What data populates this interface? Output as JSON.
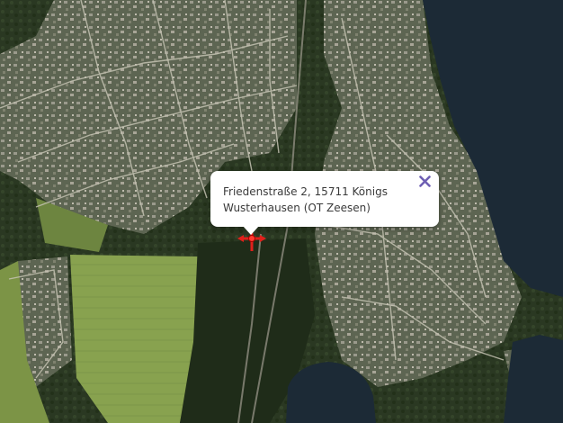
{
  "map": {
    "type": "satellite",
    "colors": {
      "forest": "#2b3a22",
      "field": "#7f9a4a",
      "water": "#1b2a36",
      "urban": "#6f7462",
      "road": "#c9c7b8",
      "marker": "#e0201b",
      "close_icon": "#6e5fb3"
    }
  },
  "popup": {
    "address": "Friedenstraße 2, 15711 Königs Wusterhausen (OT Zeesen)",
    "close_icon": "close-icon"
  },
  "marker": {
    "icon": "location-marker-icon"
  }
}
